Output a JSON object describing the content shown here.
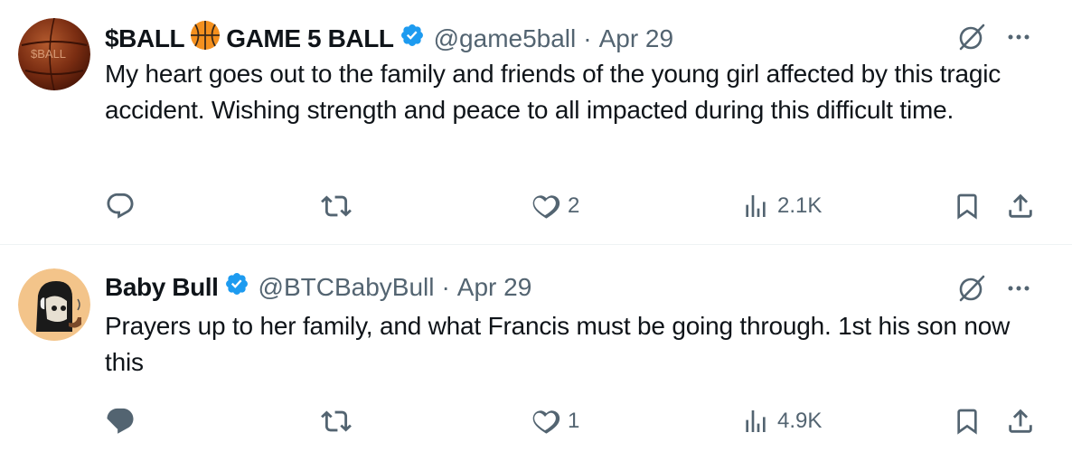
{
  "tweets": [
    {
      "display_name_part1": "$BALL",
      "emoji": "🏀",
      "display_name_part2": "GAME 5 BALL",
      "handle": "@game5ball",
      "separator": "·",
      "date": "Apr 29",
      "text": "My heart goes out to the family and friends of the young girl affected by this tragic accident. Wishing strength and peace to all impacted during this difficult time.",
      "avatar_text": "$BALL",
      "stats": {
        "replies": "",
        "reposts": "",
        "likes": "2",
        "views": "2.1K"
      }
    },
    {
      "display_name": "Baby Bull",
      "handle": "@BTCBabyBull",
      "separator": "·",
      "date": "Apr 29",
      "text": "Prayers up to her family, and what Francis must be going through. 1st his son now this",
      "stats": {
        "replies": "",
        "reposts": "",
        "likes": "1",
        "views": "4.9K"
      }
    }
  ],
  "icons": {
    "verified": "verified-badge-icon",
    "grok": "grok-icon",
    "more": "more-icon",
    "reply": "reply-icon",
    "repost": "repost-icon",
    "like": "like-icon",
    "views": "views-icon",
    "bookmark": "bookmark-icon",
    "share": "share-icon"
  },
  "colors": {
    "text": "#0f1419",
    "secondary": "#536471",
    "verified": "#1d9bf0",
    "divider": "#eff3f4"
  }
}
